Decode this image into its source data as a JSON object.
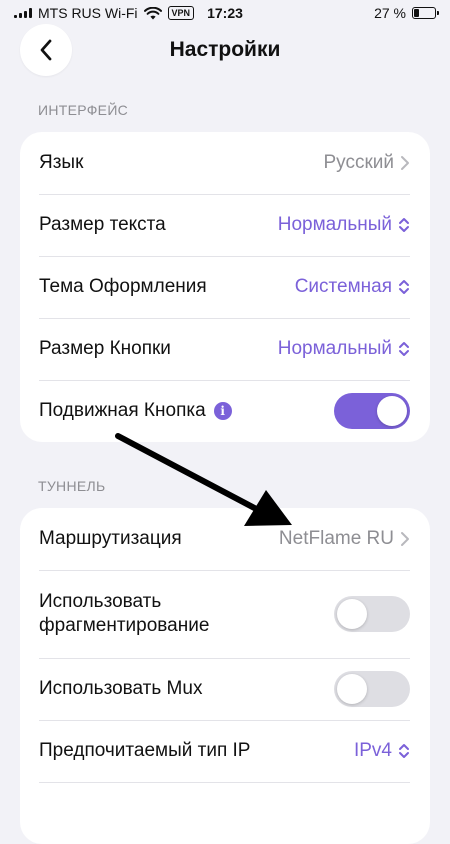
{
  "status_bar": {
    "carrier": "MTS RUS Wi-Fi",
    "vpn": "VPN",
    "time": "17:23",
    "battery_text": "27 %",
    "battery_level": 0.27
  },
  "header": {
    "title": "Настройки"
  },
  "sections": {
    "interface": {
      "label": "ИНТЕРФЕЙС",
      "rows": [
        {
          "label": "Язык",
          "value": "Русский"
        },
        {
          "label": "Размер текста",
          "value": "Нормальный"
        },
        {
          "label": "Тема Оформления",
          "value": "Системная"
        },
        {
          "label": "Размер Кнопки",
          "value": "Нормальный"
        },
        {
          "label": "Подвижная Кнопка",
          "info": "i",
          "toggle": true
        }
      ]
    },
    "tunnel": {
      "label": "ТУННЕЛЬ",
      "rows": [
        {
          "label": "Маршрутизация",
          "value": "NetFlame RU"
        },
        {
          "label": "Использовать фрагментирование",
          "toggle": false
        },
        {
          "label": "Использовать Mux",
          "toggle": false
        },
        {
          "label": "Предпочитаемый тип IP",
          "value": "IPv4"
        }
      ]
    }
  },
  "colors": {
    "accent": "#7b61d9",
    "background": "#f2f2f7",
    "secondary_text": "#8e8e93"
  }
}
